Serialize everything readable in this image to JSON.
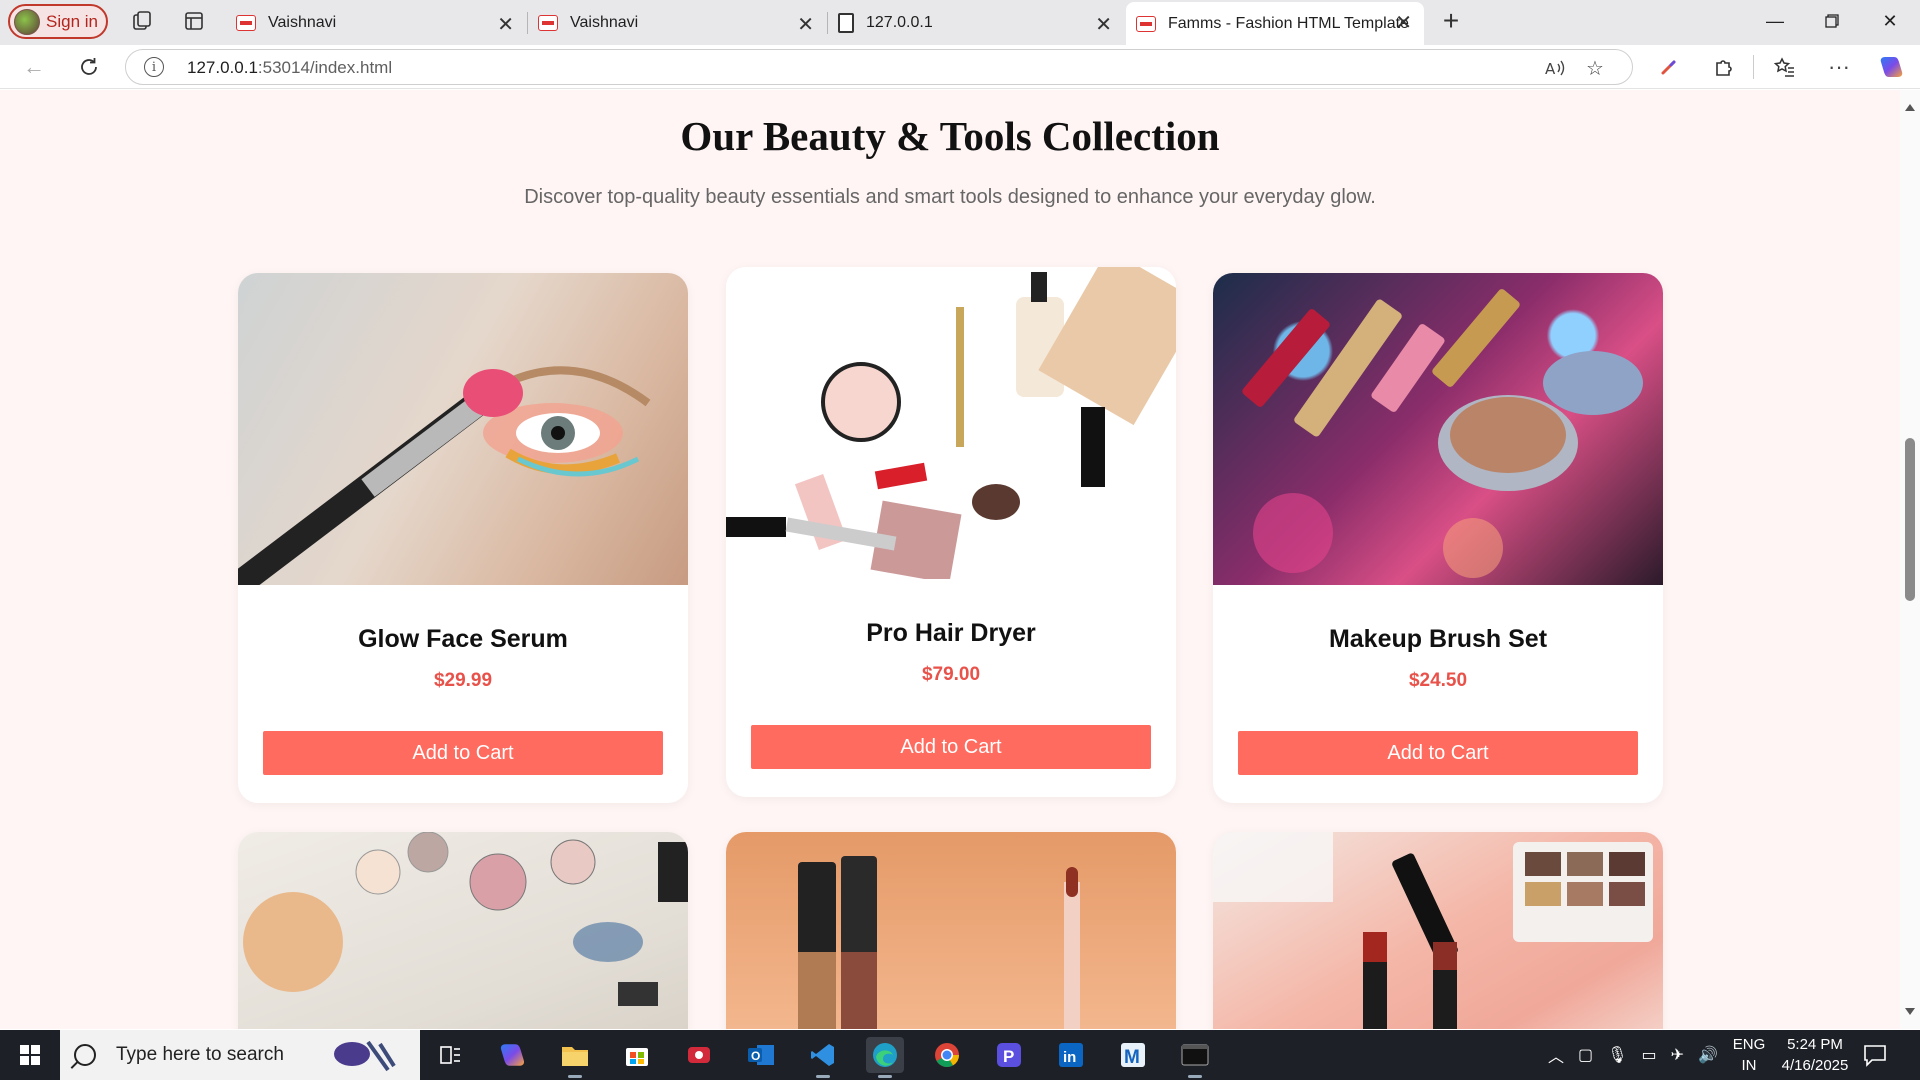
{
  "browser": {
    "signin_label": "Sign in",
    "tabs": [
      {
        "title": "Vaishnavi"
      },
      {
        "title": "Vaishnavi"
      },
      {
        "title": "127.0.0.1"
      },
      {
        "title": "Famms - Fashion HTML Template"
      }
    ],
    "url_host": "127.0.0.1",
    "url_rest": ":53014/index.html"
  },
  "section": {
    "title": "Our Beauty & Tools Collection",
    "subtitle": "Discover top-quality beauty essentials and smart tools designed to enhance your everyday glow."
  },
  "products": [
    {
      "name": "Glow Face Serum",
      "price": "$29.99",
      "button": "Add to Cart"
    },
    {
      "name": "Pro Hair Dryer",
      "price": "$79.00",
      "button": "Add to Cart"
    },
    {
      "name": "Makeup Brush Set",
      "price": "$24.50",
      "button": "Add to Cart"
    }
  ],
  "taskbar": {
    "search_placeholder": "Type here to search",
    "lang_top": "ENG",
    "lang_bottom": "IN",
    "time": "5:24 PM",
    "date": "4/16/2025"
  },
  "colors": {
    "accent": "#ff6b5f",
    "price": "#e8524a",
    "page_bg": "#fff5f4"
  }
}
